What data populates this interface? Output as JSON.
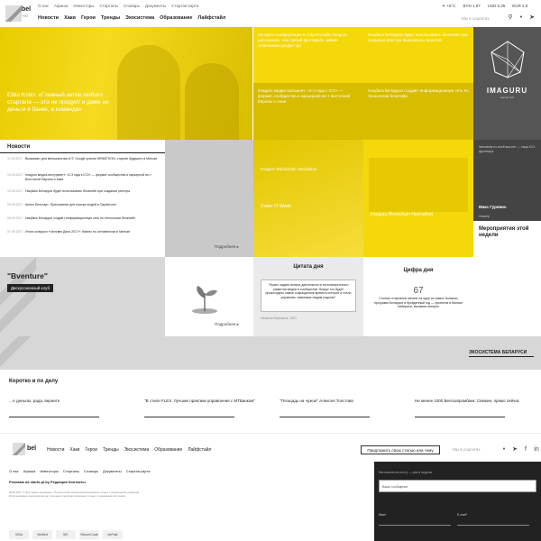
{
  "header": {
    "brand": "bel",
    "brand_sub": "+99",
    "top_links": [
      "О нас",
      "Афиша",
      "Инвесторы",
      "Стартапы",
      "Словарь",
      "Документы",
      "Стартап-карта"
    ],
    "nav": [
      "Новости",
      "Хаки",
      "Герои",
      "Тренды",
      "Экосистема",
      "Образование",
      "Лайфстайл"
    ],
    "rates": [
      "☀ +6°C",
      "BYN 1,97",
      "USD 2,35",
      "EUR 2,8"
    ],
    "search_placeholder": "Мы в соцсетях"
  },
  "hero": {
    "caption": "Elitio Kotin: «Главный актив любого стартапа — это не продукт и даже не деньги в банке, а команда»"
  },
  "tiles": [
    {
      "text": "На пресс-конференции в стартап-хабе Imaguru рассказали, чем третий фестиваль займёт отличников продукт до"
    },
    {
      "text": "Нацбанк Беларуси будет использовать блокчейн при создании реестра банковских гарантий"
    },
    {
      "text": "Imaguru медиа-шатьинет: «2-3 года к ICO» — формат сообщества и карьерной ин-т восточной Европы и Азии"
    },
    {
      "text": "Нацбанк Беларуси создаёт информационную сеть по технологии блокчейн"
    }
  ],
  "robot": {
    "name": "IMAGURU",
    "sub": "startup hub"
  },
  "news": {
    "title": "Новости",
    "items": [
      {
        "date": "11.09.2017",
        "text": "Вызывают для меньшинства в IT: Google купила HIRMOTION, стартап будущего в Минске"
      },
      {
        "date": "10.09.2017",
        "text": "Imaguru медиа-инструмент: «2-3 года к ICO» — формат сообщества и карьерной ин-т Восточной Европы и Азии"
      },
      {
        "date": "10.09.2017",
        "text": "Нацбанк Беларуси будет использовать блокчейн при создании реестра"
      },
      {
        "date": "09.09.2017",
        "text": "Анонс Белстарт: Приложение для поиска людей в Capital.com"
      },
      {
        "date": "08.09.2017",
        "text": "Нацбанк Беларуси создаёт информационную сеть по технологии блокчейн"
      },
      {
        "date": "07.09.2017",
        "text": "Итоги конкурса «Человек Дела 2017»: бизнес по-человечески в Минске"
      }
    ],
    "more": "Подробнее ▸"
  },
  "mid": {
    "tile_title": "Imaguru Blockchain Hackathon",
    "tile_sub": "Совет IT-Week",
    "hackathon": "Imaguru Blockchain Hackathon"
  },
  "speaker": {
    "top": "Чиновник по всей высоте — лица ICO-фронтира",
    "name": "Макс Гуревич",
    "role": "Спикер"
  },
  "events": {
    "title": "Мероприятия этой недели"
  },
  "bventure": {
    "title": "\"Bventure\"",
    "club": "Дискуссионный клуб"
  },
  "plant": {
    "more": "Подробнее ▸"
  },
  "quote": {
    "title": "Цитата дня",
    "text": "\"Нужно задать вопрос деятельности техноэнергичного развития медиа в сообществе. Вокруг его будет происходить самое сокращенное время в которое и стало управлять знакомым людям родство\"",
    "author": "Наталья Березина, CEO"
  },
  "figure": {
    "title": "Цифра дня",
    "number": "67",
    "text": "Столько стартапов попали на одну из самых больших программ Беларуси в пройденный год — проектов в Минске набирали, вызывая интерес"
  },
  "eco": {
    "label": "ЭКОСИСТЕМА БЕЛАРУСИ"
  },
  "short": {
    "title": "Коротко и по делу",
    "items": [
      "...А деньгах, рада, верните",
      "\"В стиле FLEX. Лучшие практики управления с МТБанком\"",
      "\"Площадь на чужое\" Алексея Толстова",
      "Не менее 1000 Белгазпромбанк: Свежие, прямо сейчас"
    ]
  },
  "footer_nav": {
    "nav": [
      "Новости",
      "Хаки",
      "Герои",
      "Тренды",
      "Экосистема",
      "Образование",
      "Лайфстайл"
    ],
    "button": "Предложить свою статью или тему",
    "search": "Мы в соцсетях"
  },
  "footer": {
    "links": [
      "О нас",
      "Афиша",
      "Инвесторы",
      "Стартапы",
      "Словарь",
      "Документы",
      "Стартап-карта"
    ],
    "ads": "Реклама на starts.pl.by   Редакция   Контакты",
    "small": "2016-2017 © Все права защищены. Перепечатка материалов возможна только с разрешения редакции. Использование материалов на сторонних ресурсах возможно только с указанием источника.",
    "payments": [
      "VISA",
      "Verified",
      "MC",
      "SecureCode",
      "bePaid"
    ],
    "subscribe_title": "Мы пишем на почту — раз в неделю",
    "subscribe_placeholder": "Ваше сообщение",
    "field1": "Имя*",
    "field2": "E-mail*"
  }
}
